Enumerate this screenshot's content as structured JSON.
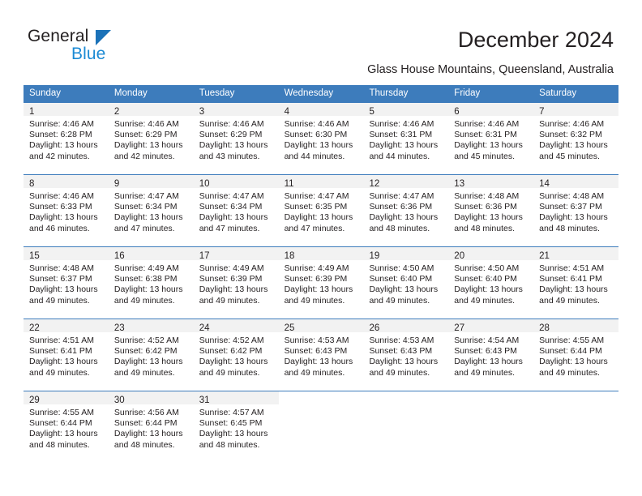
{
  "brand": {
    "name_part1": "General",
    "name_part2": "Blue",
    "triangle_color": "#1b72b8",
    "blue_color": "#1b8ad4"
  },
  "header": {
    "title": "December 2024",
    "subtitle": "Glass House Mountains, Queensland, Australia"
  },
  "theme": {
    "header_row_bg": "#3d7cbc",
    "week_border": "#3d7cbc",
    "daynum_strip_bg": "#f2f2f2",
    "text": "#231f20"
  },
  "calendar": {
    "day_names": [
      "Sunday",
      "Monday",
      "Tuesday",
      "Wednesday",
      "Thursday",
      "Friday",
      "Saturday"
    ],
    "weeks": [
      [
        {
          "day": "1",
          "sunrise": "Sunrise: 4:46 AM",
          "sunset": "Sunset: 6:28 PM",
          "daylight1": "Daylight: 13 hours",
          "daylight2": "and 42 minutes."
        },
        {
          "day": "2",
          "sunrise": "Sunrise: 4:46 AM",
          "sunset": "Sunset: 6:29 PM",
          "daylight1": "Daylight: 13 hours",
          "daylight2": "and 42 minutes."
        },
        {
          "day": "3",
          "sunrise": "Sunrise: 4:46 AM",
          "sunset": "Sunset: 6:29 PM",
          "daylight1": "Daylight: 13 hours",
          "daylight2": "and 43 minutes."
        },
        {
          "day": "4",
          "sunrise": "Sunrise: 4:46 AM",
          "sunset": "Sunset: 6:30 PM",
          "daylight1": "Daylight: 13 hours",
          "daylight2": "and 44 minutes."
        },
        {
          "day": "5",
          "sunrise": "Sunrise: 4:46 AM",
          "sunset": "Sunset: 6:31 PM",
          "daylight1": "Daylight: 13 hours",
          "daylight2": "and 44 minutes."
        },
        {
          "day": "6",
          "sunrise": "Sunrise: 4:46 AM",
          "sunset": "Sunset: 6:31 PM",
          "daylight1": "Daylight: 13 hours",
          "daylight2": "and 45 minutes."
        },
        {
          "day": "7",
          "sunrise": "Sunrise: 4:46 AM",
          "sunset": "Sunset: 6:32 PM",
          "daylight1": "Daylight: 13 hours",
          "daylight2": "and 45 minutes."
        }
      ],
      [
        {
          "day": "8",
          "sunrise": "Sunrise: 4:46 AM",
          "sunset": "Sunset: 6:33 PM",
          "daylight1": "Daylight: 13 hours",
          "daylight2": "and 46 minutes."
        },
        {
          "day": "9",
          "sunrise": "Sunrise: 4:47 AM",
          "sunset": "Sunset: 6:34 PM",
          "daylight1": "Daylight: 13 hours",
          "daylight2": "and 47 minutes."
        },
        {
          "day": "10",
          "sunrise": "Sunrise: 4:47 AM",
          "sunset": "Sunset: 6:34 PM",
          "daylight1": "Daylight: 13 hours",
          "daylight2": "and 47 minutes."
        },
        {
          "day": "11",
          "sunrise": "Sunrise: 4:47 AM",
          "sunset": "Sunset: 6:35 PM",
          "daylight1": "Daylight: 13 hours",
          "daylight2": "and 47 minutes."
        },
        {
          "day": "12",
          "sunrise": "Sunrise: 4:47 AM",
          "sunset": "Sunset: 6:36 PM",
          "daylight1": "Daylight: 13 hours",
          "daylight2": "and 48 minutes."
        },
        {
          "day": "13",
          "sunrise": "Sunrise: 4:48 AM",
          "sunset": "Sunset: 6:36 PM",
          "daylight1": "Daylight: 13 hours",
          "daylight2": "and 48 minutes."
        },
        {
          "day": "14",
          "sunrise": "Sunrise: 4:48 AM",
          "sunset": "Sunset: 6:37 PM",
          "daylight1": "Daylight: 13 hours",
          "daylight2": "and 48 minutes."
        }
      ],
      [
        {
          "day": "15",
          "sunrise": "Sunrise: 4:48 AM",
          "sunset": "Sunset: 6:37 PM",
          "daylight1": "Daylight: 13 hours",
          "daylight2": "and 49 minutes."
        },
        {
          "day": "16",
          "sunrise": "Sunrise: 4:49 AM",
          "sunset": "Sunset: 6:38 PM",
          "daylight1": "Daylight: 13 hours",
          "daylight2": "and 49 minutes."
        },
        {
          "day": "17",
          "sunrise": "Sunrise: 4:49 AM",
          "sunset": "Sunset: 6:39 PM",
          "daylight1": "Daylight: 13 hours",
          "daylight2": "and 49 minutes."
        },
        {
          "day": "18",
          "sunrise": "Sunrise: 4:49 AM",
          "sunset": "Sunset: 6:39 PM",
          "daylight1": "Daylight: 13 hours",
          "daylight2": "and 49 minutes."
        },
        {
          "day": "19",
          "sunrise": "Sunrise: 4:50 AM",
          "sunset": "Sunset: 6:40 PM",
          "daylight1": "Daylight: 13 hours",
          "daylight2": "and 49 minutes."
        },
        {
          "day": "20",
          "sunrise": "Sunrise: 4:50 AM",
          "sunset": "Sunset: 6:40 PM",
          "daylight1": "Daylight: 13 hours",
          "daylight2": "and 49 minutes."
        },
        {
          "day": "21",
          "sunrise": "Sunrise: 4:51 AM",
          "sunset": "Sunset: 6:41 PM",
          "daylight1": "Daylight: 13 hours",
          "daylight2": "and 49 minutes."
        }
      ],
      [
        {
          "day": "22",
          "sunrise": "Sunrise: 4:51 AM",
          "sunset": "Sunset: 6:41 PM",
          "daylight1": "Daylight: 13 hours",
          "daylight2": "and 49 minutes."
        },
        {
          "day": "23",
          "sunrise": "Sunrise: 4:52 AM",
          "sunset": "Sunset: 6:42 PM",
          "daylight1": "Daylight: 13 hours",
          "daylight2": "and 49 minutes."
        },
        {
          "day": "24",
          "sunrise": "Sunrise: 4:52 AM",
          "sunset": "Sunset: 6:42 PM",
          "daylight1": "Daylight: 13 hours",
          "daylight2": "and 49 minutes."
        },
        {
          "day": "25",
          "sunrise": "Sunrise: 4:53 AM",
          "sunset": "Sunset: 6:43 PM",
          "daylight1": "Daylight: 13 hours",
          "daylight2": "and 49 minutes."
        },
        {
          "day": "26",
          "sunrise": "Sunrise: 4:53 AM",
          "sunset": "Sunset: 6:43 PM",
          "daylight1": "Daylight: 13 hours",
          "daylight2": "and 49 minutes."
        },
        {
          "day": "27",
          "sunrise": "Sunrise: 4:54 AM",
          "sunset": "Sunset: 6:43 PM",
          "daylight1": "Daylight: 13 hours",
          "daylight2": "and 49 minutes."
        },
        {
          "day": "28",
          "sunrise": "Sunrise: 4:55 AM",
          "sunset": "Sunset: 6:44 PM",
          "daylight1": "Daylight: 13 hours",
          "daylight2": "and 49 minutes."
        }
      ],
      [
        {
          "day": "29",
          "sunrise": "Sunrise: 4:55 AM",
          "sunset": "Sunset: 6:44 PM",
          "daylight1": "Daylight: 13 hours",
          "daylight2": "and 48 minutes."
        },
        {
          "day": "30",
          "sunrise": "Sunrise: 4:56 AM",
          "sunset": "Sunset: 6:44 PM",
          "daylight1": "Daylight: 13 hours",
          "daylight2": "and 48 minutes."
        },
        {
          "day": "31",
          "sunrise": "Sunrise: 4:57 AM",
          "sunset": "Sunset: 6:45 PM",
          "daylight1": "Daylight: 13 hours",
          "daylight2": "and 48 minutes."
        },
        null,
        null,
        null,
        null
      ]
    ]
  }
}
